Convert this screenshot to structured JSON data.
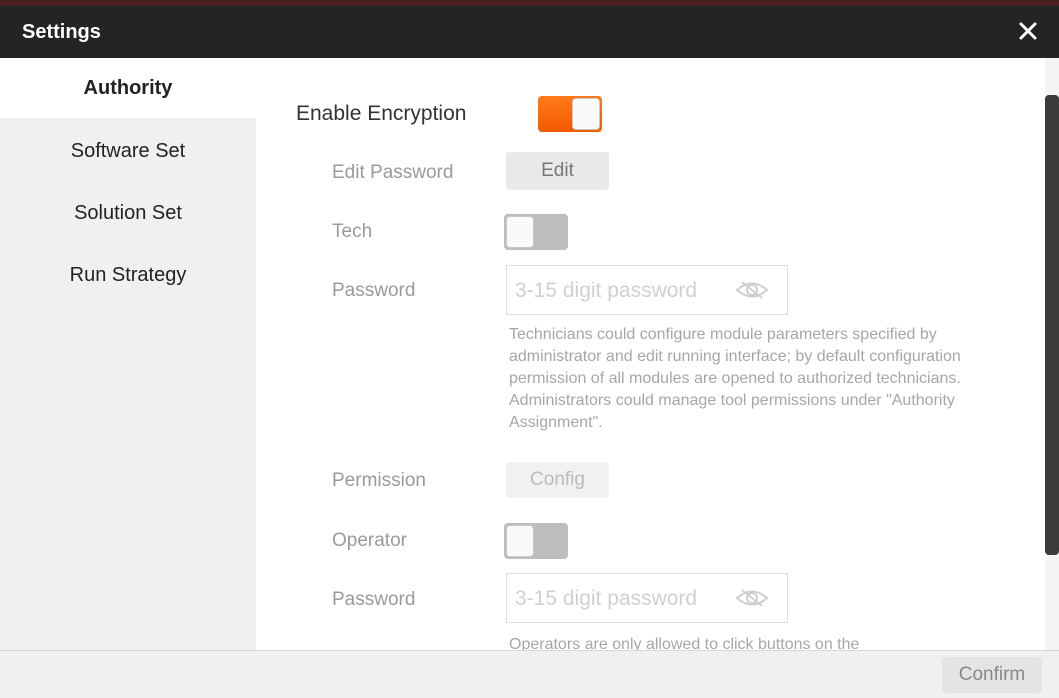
{
  "window": {
    "title": "Settings"
  },
  "sidebar": {
    "items": [
      {
        "label": "Authority",
        "active": true
      },
      {
        "label": "Software Set",
        "active": false
      },
      {
        "label": "Solution Set",
        "active": false
      },
      {
        "label": "Run Strategy",
        "active": false
      }
    ]
  },
  "authority": {
    "enable_encryption": {
      "label": "Enable Encryption",
      "state": "on"
    },
    "edit_password": {
      "label": "Edit Password",
      "button": "Edit"
    },
    "tech": {
      "label": "Tech",
      "state": "off"
    },
    "tech_password": {
      "label": "Password",
      "placeholder": "3-15 digit password",
      "value": ""
    },
    "tech_description": "Technicians could configure module parameters specified by administrator and edit running interface; by default configuration permission of all modules are opened to authorized technicians. Administrators could manage tool permissions under \"Authority Assignment\".",
    "permission": {
      "label": "Permission",
      "button": "Config"
    },
    "operator": {
      "label": "Operator",
      "state": "off"
    },
    "operator_password": {
      "label": "Password",
      "placeholder": "3-15 digit password",
      "value": ""
    },
    "operator_description": "Operators are only allowed to click buttons on the"
  },
  "footer": {
    "confirm_label": "Confirm"
  },
  "colors": {
    "accent": "#ff6a0f",
    "titlebar": "#242424",
    "sidebar_bg": "#f0f0f0"
  },
  "icons": {
    "close": "close-icon",
    "eye": "eye-icon"
  }
}
